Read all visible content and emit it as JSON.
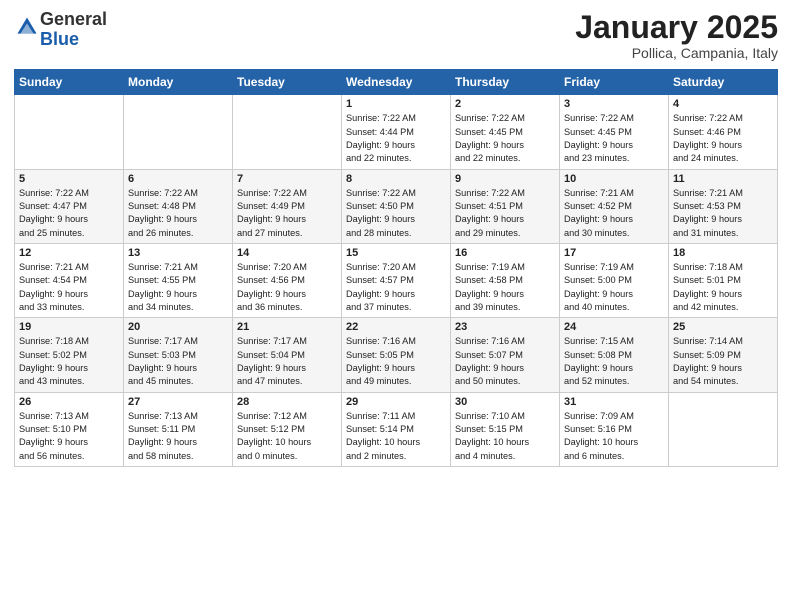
{
  "header": {
    "logo_general": "General",
    "logo_blue": "Blue",
    "month_title": "January 2025",
    "location": "Pollica, Campania, Italy"
  },
  "weekdays": [
    "Sunday",
    "Monday",
    "Tuesday",
    "Wednesday",
    "Thursday",
    "Friday",
    "Saturday"
  ],
  "rows": [
    [
      {
        "day": "",
        "info": ""
      },
      {
        "day": "",
        "info": ""
      },
      {
        "day": "",
        "info": ""
      },
      {
        "day": "1",
        "info": "Sunrise: 7:22 AM\nSunset: 4:44 PM\nDaylight: 9 hours\nand 22 minutes."
      },
      {
        "day": "2",
        "info": "Sunrise: 7:22 AM\nSunset: 4:45 PM\nDaylight: 9 hours\nand 22 minutes."
      },
      {
        "day": "3",
        "info": "Sunrise: 7:22 AM\nSunset: 4:45 PM\nDaylight: 9 hours\nand 23 minutes."
      },
      {
        "day": "4",
        "info": "Sunrise: 7:22 AM\nSunset: 4:46 PM\nDaylight: 9 hours\nand 24 minutes."
      }
    ],
    [
      {
        "day": "5",
        "info": "Sunrise: 7:22 AM\nSunset: 4:47 PM\nDaylight: 9 hours\nand 25 minutes."
      },
      {
        "day": "6",
        "info": "Sunrise: 7:22 AM\nSunset: 4:48 PM\nDaylight: 9 hours\nand 26 minutes."
      },
      {
        "day": "7",
        "info": "Sunrise: 7:22 AM\nSunset: 4:49 PM\nDaylight: 9 hours\nand 27 minutes."
      },
      {
        "day": "8",
        "info": "Sunrise: 7:22 AM\nSunset: 4:50 PM\nDaylight: 9 hours\nand 28 minutes."
      },
      {
        "day": "9",
        "info": "Sunrise: 7:22 AM\nSunset: 4:51 PM\nDaylight: 9 hours\nand 29 minutes."
      },
      {
        "day": "10",
        "info": "Sunrise: 7:21 AM\nSunset: 4:52 PM\nDaylight: 9 hours\nand 30 minutes."
      },
      {
        "day": "11",
        "info": "Sunrise: 7:21 AM\nSunset: 4:53 PM\nDaylight: 9 hours\nand 31 minutes."
      }
    ],
    [
      {
        "day": "12",
        "info": "Sunrise: 7:21 AM\nSunset: 4:54 PM\nDaylight: 9 hours\nand 33 minutes."
      },
      {
        "day": "13",
        "info": "Sunrise: 7:21 AM\nSunset: 4:55 PM\nDaylight: 9 hours\nand 34 minutes."
      },
      {
        "day": "14",
        "info": "Sunrise: 7:20 AM\nSunset: 4:56 PM\nDaylight: 9 hours\nand 36 minutes."
      },
      {
        "day": "15",
        "info": "Sunrise: 7:20 AM\nSunset: 4:57 PM\nDaylight: 9 hours\nand 37 minutes."
      },
      {
        "day": "16",
        "info": "Sunrise: 7:19 AM\nSunset: 4:58 PM\nDaylight: 9 hours\nand 39 minutes."
      },
      {
        "day": "17",
        "info": "Sunrise: 7:19 AM\nSunset: 5:00 PM\nDaylight: 9 hours\nand 40 minutes."
      },
      {
        "day": "18",
        "info": "Sunrise: 7:18 AM\nSunset: 5:01 PM\nDaylight: 9 hours\nand 42 minutes."
      }
    ],
    [
      {
        "day": "19",
        "info": "Sunrise: 7:18 AM\nSunset: 5:02 PM\nDaylight: 9 hours\nand 43 minutes."
      },
      {
        "day": "20",
        "info": "Sunrise: 7:17 AM\nSunset: 5:03 PM\nDaylight: 9 hours\nand 45 minutes."
      },
      {
        "day": "21",
        "info": "Sunrise: 7:17 AM\nSunset: 5:04 PM\nDaylight: 9 hours\nand 47 minutes."
      },
      {
        "day": "22",
        "info": "Sunrise: 7:16 AM\nSunset: 5:05 PM\nDaylight: 9 hours\nand 49 minutes."
      },
      {
        "day": "23",
        "info": "Sunrise: 7:16 AM\nSunset: 5:07 PM\nDaylight: 9 hours\nand 50 minutes."
      },
      {
        "day": "24",
        "info": "Sunrise: 7:15 AM\nSunset: 5:08 PM\nDaylight: 9 hours\nand 52 minutes."
      },
      {
        "day": "25",
        "info": "Sunrise: 7:14 AM\nSunset: 5:09 PM\nDaylight: 9 hours\nand 54 minutes."
      }
    ],
    [
      {
        "day": "26",
        "info": "Sunrise: 7:13 AM\nSunset: 5:10 PM\nDaylight: 9 hours\nand 56 minutes."
      },
      {
        "day": "27",
        "info": "Sunrise: 7:13 AM\nSunset: 5:11 PM\nDaylight: 9 hours\nand 58 minutes."
      },
      {
        "day": "28",
        "info": "Sunrise: 7:12 AM\nSunset: 5:12 PM\nDaylight: 10 hours\nand 0 minutes."
      },
      {
        "day": "29",
        "info": "Sunrise: 7:11 AM\nSunset: 5:14 PM\nDaylight: 10 hours\nand 2 minutes."
      },
      {
        "day": "30",
        "info": "Sunrise: 7:10 AM\nSunset: 5:15 PM\nDaylight: 10 hours\nand 4 minutes."
      },
      {
        "day": "31",
        "info": "Sunrise: 7:09 AM\nSunset: 5:16 PM\nDaylight: 10 hours\nand 6 minutes."
      },
      {
        "day": "",
        "info": ""
      }
    ]
  ]
}
